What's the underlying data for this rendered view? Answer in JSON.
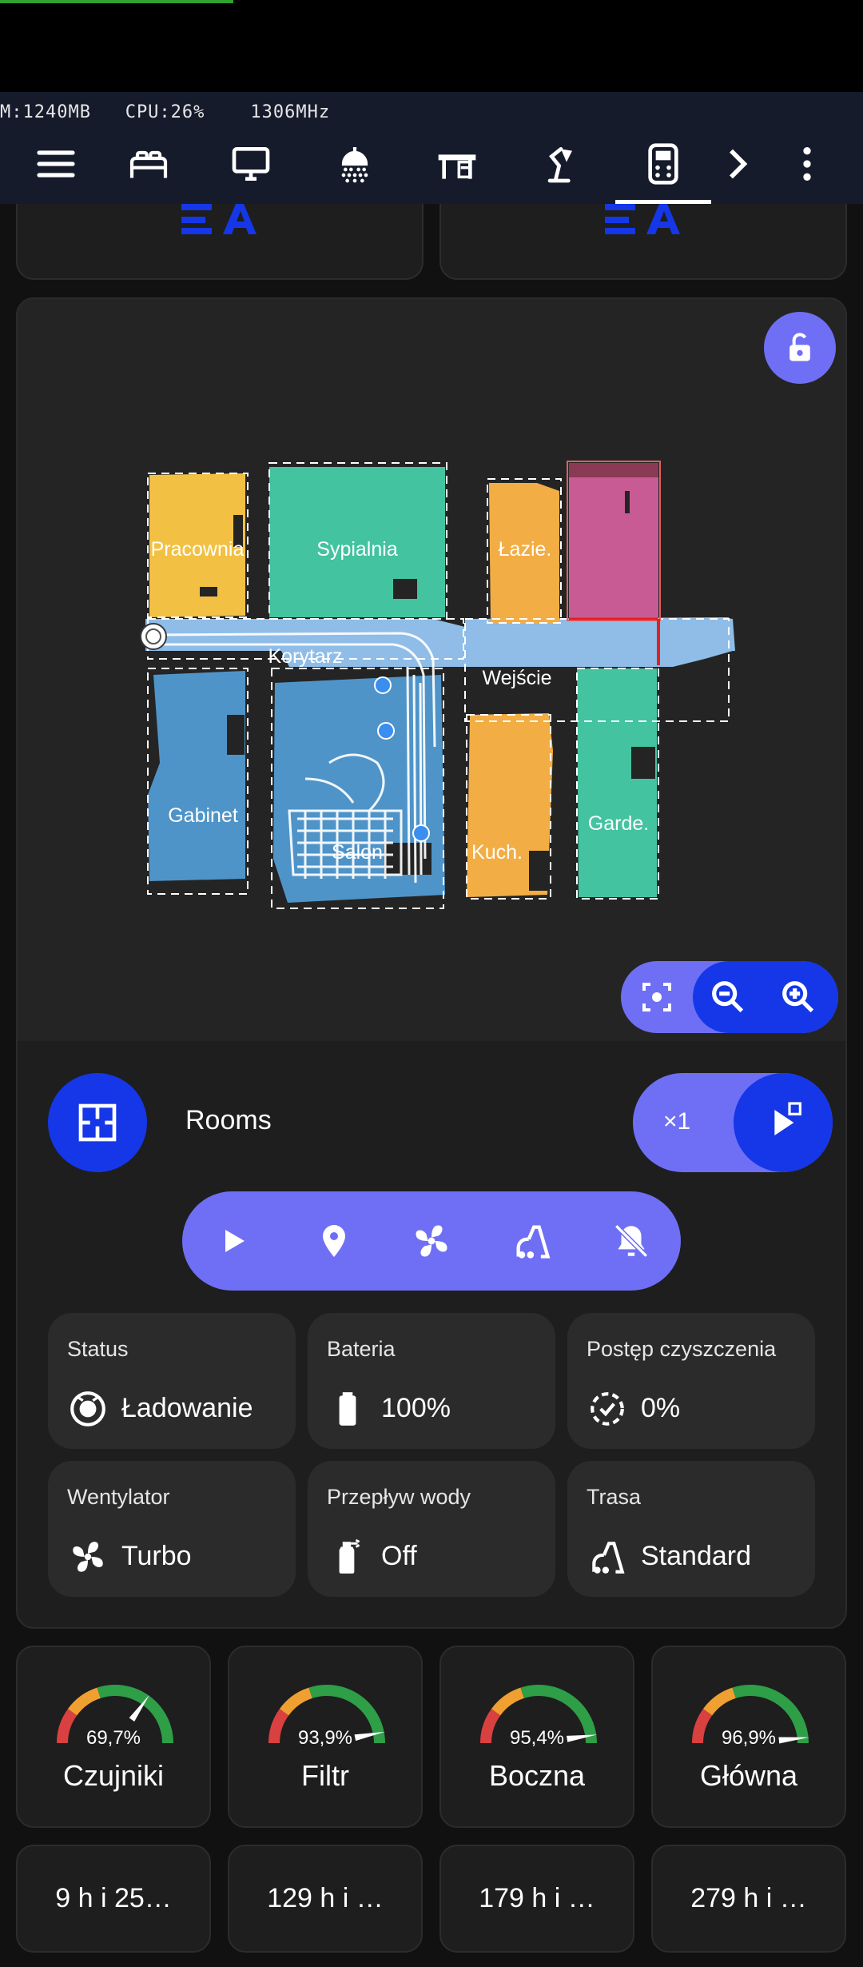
{
  "status_bar": {
    "progress": 0.27
  },
  "header": {
    "system_info": "M:1240MB   CPU:26%    1306MHz",
    "nav_icons": [
      "menu-icon",
      "bed-icon",
      "monitor-icon",
      "shower-icon",
      "desk-icon",
      "desk-lamp-icon",
      "robot-vacuum-icon",
      "chevron-right-icon",
      "more-vert-icon"
    ],
    "selected_tab": "robot-vacuum-icon"
  },
  "map": {
    "rooms": [
      "Pracownia",
      "Sypialnia",
      "Łazie.",
      "Korytarz",
      "Wejście",
      "Gabinet",
      "Salon",
      "Kuch.",
      "Garde."
    ],
    "locked_icon": "lock-open-icon",
    "zoom_icons": [
      "recenter-icon",
      "zoom-out-icon",
      "zoom-in-icon"
    ]
  },
  "mode": {
    "label": "Rooms",
    "repeat": "×1"
  },
  "actions": [
    "play-icon",
    "location-pin-icon",
    "fan-icon",
    "vacuum-icon",
    "locate-off-icon"
  ],
  "tiles": [
    {
      "label": "Status",
      "value": "Ładowanie",
      "icon": "robot-icon"
    },
    {
      "label": "Bateria",
      "value": "100%",
      "icon": "battery-icon"
    },
    {
      "label": "Postęp czyszczenia",
      "value": "0%",
      "icon": "progress-check-icon"
    },
    {
      "label": "Wentylator",
      "value": "Turbo",
      "icon": "fan-icon"
    },
    {
      "label": "Przepływ wody",
      "value": "Off",
      "icon": "spray-bottle-icon"
    },
    {
      "label": "Trasa",
      "value": "Standard",
      "icon": "vacuum-icon"
    }
  ],
  "gauges": [
    {
      "value_text": "69,7%",
      "value": 69.7,
      "label": "Czujniki"
    },
    {
      "value_text": "93,9%",
      "value": 93.9,
      "label": "Filtr"
    },
    {
      "value_text": "95,4%",
      "value": 95.4,
      "label": "Boczna"
    },
    {
      "value_text": "96,9%",
      "value": 96.9,
      "label": "Główna"
    }
  ],
  "times": [
    "9 h i 25…",
    "129 h i …",
    "179 h i …",
    "279 h i …"
  ],
  "colors": {
    "accent": "#6f6ff5",
    "accent_dark": "#1537e8",
    "gauge_green": "#2e9e47",
    "gauge_orange": "#f0a030",
    "gauge_red": "#d94040"
  }
}
